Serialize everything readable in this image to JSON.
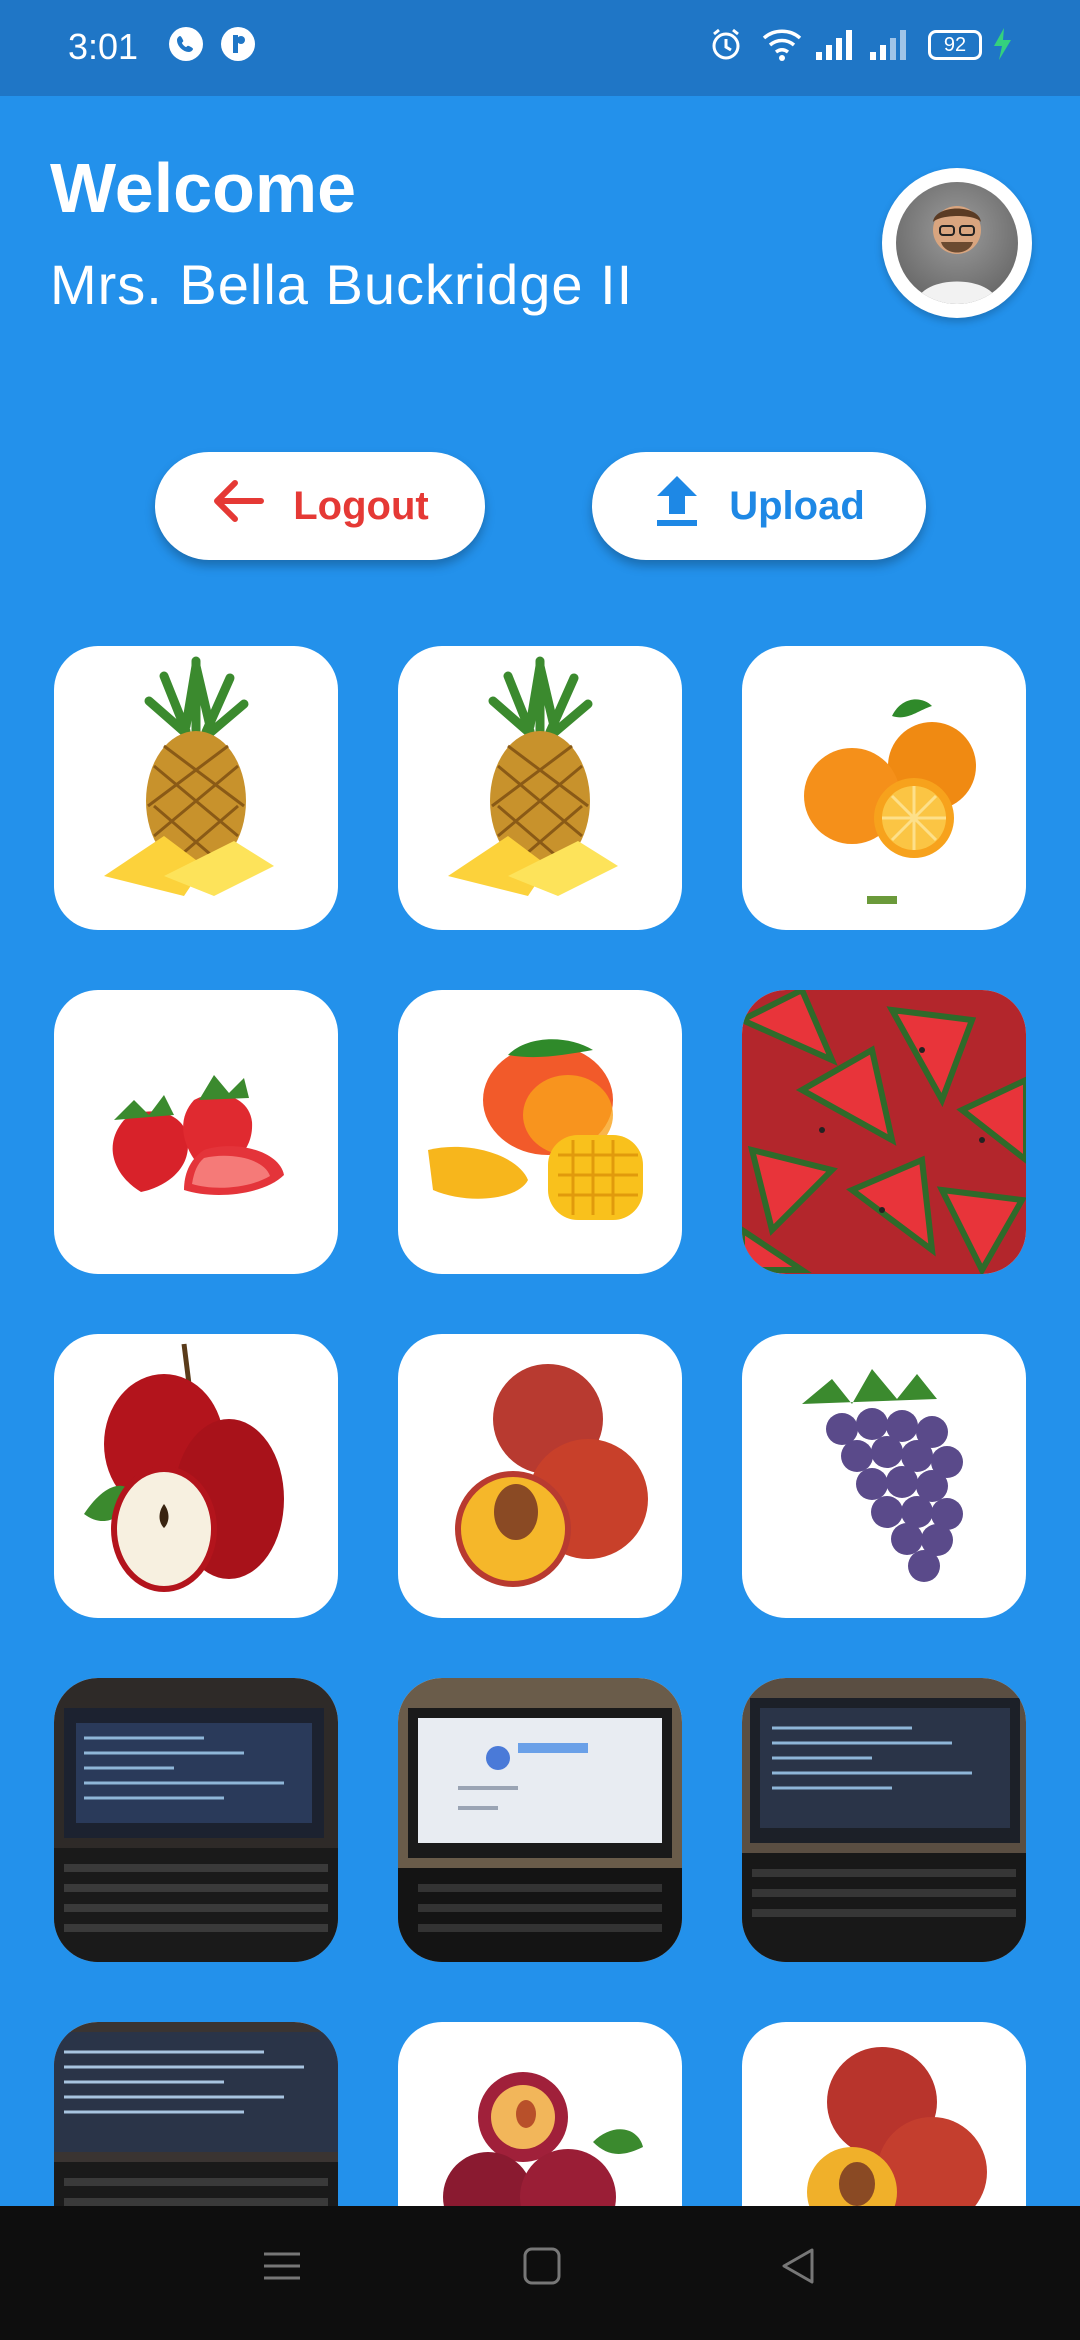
{
  "status_bar": {
    "time": "3:01",
    "battery": "92",
    "icons": [
      "call-icon",
      "notification-icon",
      "alarm-icon",
      "wifi-icon",
      "signal-icon",
      "signal-icon",
      "battery-icon",
      "charging-icon"
    ]
  },
  "header": {
    "welcome": "Welcome",
    "user_name": "Mrs. Bella Buckridge II",
    "avatar_icon": "profile-avatar"
  },
  "actions": {
    "logout_label": "Logout",
    "upload_label": "Upload",
    "logout_color": "#e53935",
    "upload_color": "#1e88e5"
  },
  "gallery": {
    "items": [
      "pineapple",
      "pineapple",
      "orange",
      "strawberry",
      "mango",
      "watermelon",
      "apple",
      "peach",
      "grapes",
      "laptop-photo",
      "laptop-photo",
      "laptop-photo",
      "laptop-photo",
      "plum",
      "peach"
    ]
  },
  "colors": {
    "background": "#2391eb",
    "status_bar": "#1f76c6"
  },
  "nav_bar": {
    "icons": [
      "menu-icon",
      "home-icon",
      "back-icon"
    ]
  }
}
